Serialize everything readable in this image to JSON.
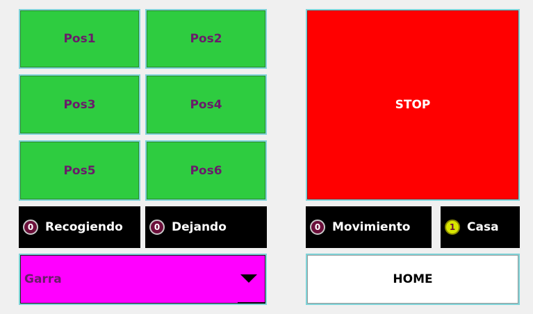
{
  "positions": {
    "pos1": "Pos1",
    "pos2": "Pos2",
    "pos3": "Pos3",
    "pos4": "Pos4",
    "pos5": "Pos5",
    "pos6": "Pos6"
  },
  "stop": {
    "label": "STOP"
  },
  "home": {
    "label": "HOME"
  },
  "indicators": {
    "recogiendo": {
      "value": "0",
      "label": "Recogiendo"
    },
    "dejando": {
      "value": "0",
      "label": "Dejando"
    },
    "movimiento": {
      "value": "0",
      "label": "Movimiento"
    },
    "casa": {
      "value": "1",
      "label": "Casa"
    }
  },
  "tool_select": {
    "value": "Garra"
  },
  "colors": {
    "position_button": "#2ecc40",
    "stop_button": "#ff0000",
    "dropdown": "#ff00ff",
    "indicator_off": "#6b0f3a",
    "indicator_on": "#d8e600"
  }
}
